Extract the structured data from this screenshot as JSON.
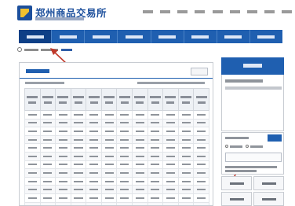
{
  "header": {
    "logo_text": "郑州商品交易所",
    "logo_subtitle": "",
    "top_links": [
      "",
      "",
      "",
      "",
      "",
      "",
      "",
      "",
      ""
    ]
  },
  "nav": {
    "items": [
      {
        "label": "",
        "active": true
      },
      {
        "label": "",
        "active": false
      },
      {
        "label": "",
        "active": false
      },
      {
        "label": "",
        "active": false
      },
      {
        "label": "",
        "active": false
      },
      {
        "label": "",
        "active": false
      },
      {
        "label": "",
        "active": false
      },
      {
        "label": "",
        "active": false
      }
    ]
  },
  "breadcrumb": {
    "items": [
      "",
      "",
      ""
    ]
  },
  "report": {
    "title": "",
    "export_label": "",
    "meta_left": "",
    "meta_right": "",
    "columns": [
      "",
      "",
      "",
      "",
      "",
      "",
      "",
      "",
      "",
      "",
      "",
      ""
    ],
    "rows": [
      [
        "",
        "",
        "",
        "",
        "",
        "",
        "",
        "",
        "",
        "",
        "",
        ""
      ],
      [
        "",
        "",
        "",
        "",
        "",
        "",
        "",
        "",
        "",
        "",
        "",
        ""
      ],
      [
        "",
        "",
        "",
        "",
        "",
        "",
        "",
        "",
        "",
        "",
        "",
        ""
      ],
      [
        "",
        "",
        "",
        "",
        "",
        "",
        "",
        "",
        "",
        "",
        "",
        ""
      ],
      [
        "",
        "",
        "",
        "",
        "",
        "",
        "",
        "",
        "",
        "",
        "",
        ""
      ],
      [
        "",
        "",
        "",
        "",
        "",
        "",
        "",
        "",
        "",
        "",
        "",
        ""
      ],
      [
        "",
        "",
        "",
        "",
        "",
        "",
        "",
        "",
        "",
        "",
        "",
        ""
      ],
      [
        "",
        "",
        "",
        "",
        "",
        "",
        "",
        "",
        "",
        "",
        "",
        ""
      ],
      [
        "",
        "",
        "",
        "",
        "",
        "",
        "",
        "",
        "",
        "",
        "",
        ""
      ],
      [
        "",
        "",
        "",
        "",
        "",
        "",
        "",
        "",
        "",
        "",
        "",
        ""
      ],
      [
        "",
        "",
        "",
        "",
        "",
        "",
        "",
        "",
        "",
        "",
        "",
        ""
      ],
      [
        "",
        "",
        "",
        "",
        "",
        "",
        "",
        "",
        "",
        "",
        "",
        ""
      ]
    ]
  },
  "calendar": {
    "title": "",
    "month_label": "",
    "weekday_labels": [
      "",
      "",
      "",
      "",
      "",
      "",
      ""
    ],
    "days": [
      "",
      "",
      "",
      "",
      "",
      "",
      "",
      "",
      "",
      "",
      "",
      "",
      "",
      "",
      "",
      "",
      "",
      "",
      "",
      "",
      "",
      "",
      "",
      "",
      "",
      "",
      "",
      ""
    ]
  },
  "query": {
    "label": "",
    "options": [
      "",
      ""
    ],
    "submit_label": "",
    "input_placeholder": "",
    "hint": ""
  },
  "quick_links": [
    "",
    "",
    "",
    ""
  ],
  "colors": {
    "brand": "#1f5fb0",
    "nav_active": "#0e3f86",
    "accent": "#f2c12e",
    "annotation_arrow": "#c0392b"
  }
}
